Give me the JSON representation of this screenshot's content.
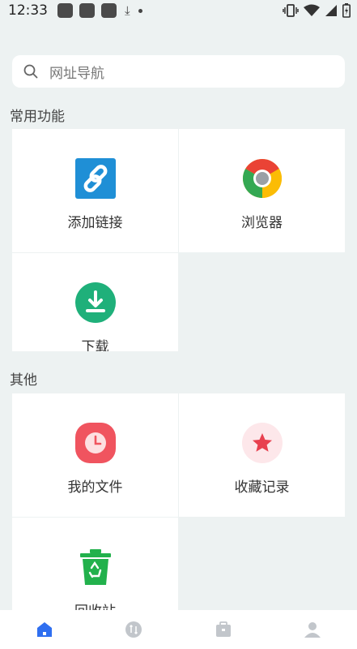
{
  "status_bar": {
    "time": "12:33"
  },
  "search": {
    "placeholder": "网址导航"
  },
  "sections": [
    {
      "title": "常用功能",
      "items": [
        {
          "label": "添加链接"
        },
        {
          "label": "浏览器"
        },
        {
          "label": "下载"
        }
      ]
    },
    {
      "title": "其他",
      "items": [
        {
          "label": "我的文件"
        },
        {
          "label": "收藏记录"
        },
        {
          "label": "回收站"
        }
      ]
    }
  ],
  "bottom_nav": [
    "home-icon",
    "transfer-icon",
    "toolbox-icon",
    "profile-icon"
  ],
  "colors": {
    "accent": "#2f6ff0",
    "link_bg": "#1f8fd6",
    "download": "#1fb07a",
    "file": "#f0545f",
    "star": "#e8404f",
    "recycle": "#22b14c"
  }
}
